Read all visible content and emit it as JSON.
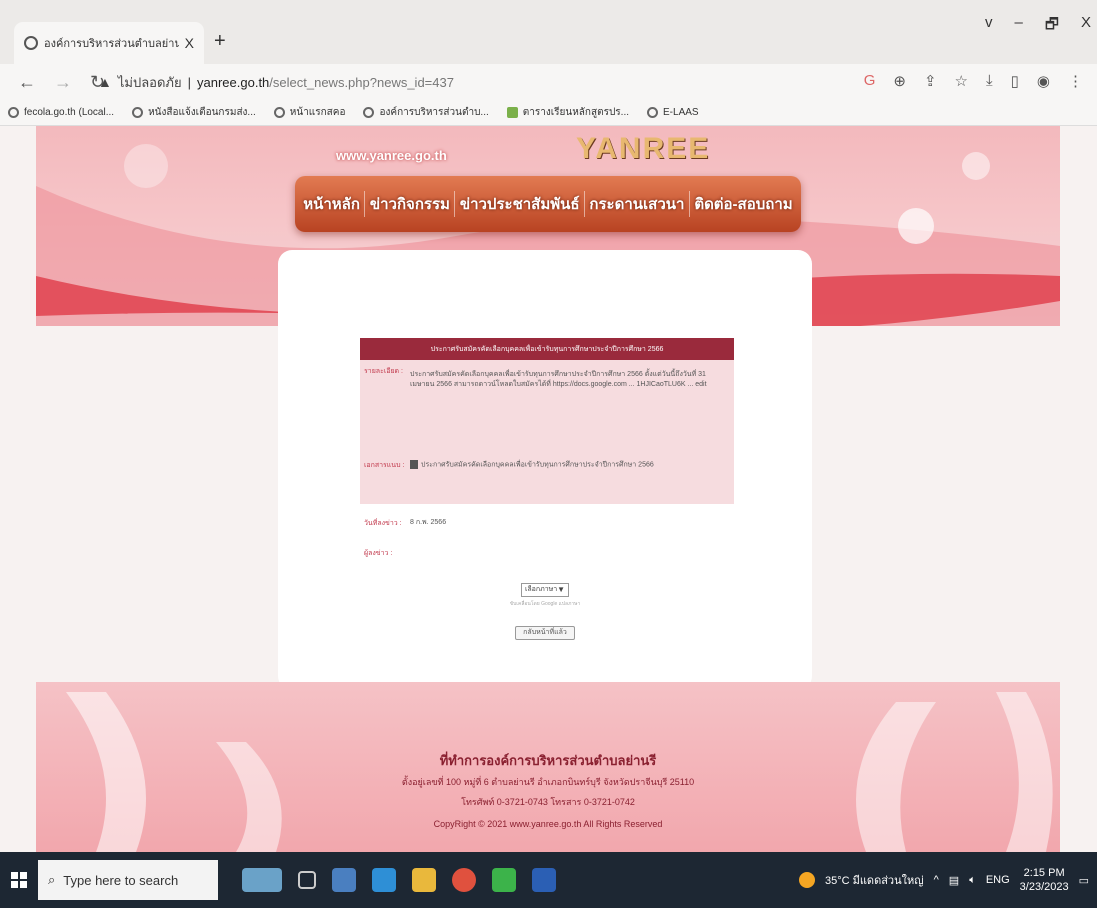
{
  "browser": {
    "tab_title": "องค์การบริหารส่วนตำบลย่านรี อำเภอ",
    "tab_close": "X",
    "new_tab": "+",
    "window_controls": [
      "v",
      "–",
      "🗗",
      "X"
    ],
    "address": {
      "secure_text": "ไม่ปลอดภัย",
      "separator": "|",
      "host": "yanree.go.th",
      "path": "/select_news.php?news_id=437"
    },
    "bookmarks": [
      "fecola.go.th (Local...",
      "หนังสือแจ้งเตือนกรมส่ง...",
      "หน้าแรกสคอ",
      "องค์การบริหารส่วนตำบ...",
      "ตารางเรียนหลักสูตรปร...",
      "E-LAAS"
    ]
  },
  "site": {
    "domain": "www.yanree.go.th",
    "logo_text": "YANREE",
    "menu": [
      "หน้าหลัก",
      "ข่าวกิจกรรม",
      "ข่าวประชาสัมพันธ์",
      "กระดานเสวนา",
      "ติดต่อ-สอบถาม"
    ]
  },
  "news": {
    "header": "ประกาศรับสมัครคัดเลือกบุคคลเพื่อเข้ารับทุนการศึกษาประจำปีการศึกษา 2566",
    "detail_label": "รายละเอียด :",
    "detail_text": "ประกาศรับสมัครคัดเลือกบุคคลเพื่อเข้ารับทุนการศึกษาประจำปีการศึกษา 2566 ตั้งแต่วันนี้ถึงวันที่ 31 เมษายน 2566 สามารถดาวน์โหลดใบสมัครได้ที่ https://docs.google.com ... 1HJICaoTLU6K ... edit",
    "attach_label": "เอกสารแนบ :",
    "attach_text": "ประกาศรับสมัครคัดเลือกบุคคลเพื่อเข้ารับทุนการศึกษาประจำปีการศึกษา 2566",
    "date_label": "วันที่ลงข่าว :",
    "date_value": "8 ก.พ. 2566",
    "poster_label": "ผู้ลงข่าว :",
    "poster_value": ""
  },
  "controls": {
    "language_select": "เลือกภาษา",
    "powered_by": "ขับเคลื่อนโดย Google แปลภาษา",
    "back_button": "กลับหน้าที่แล้ว"
  },
  "footer": {
    "title": "ที่ทำการองค์การบริหารส่วนตำบลย่านรี",
    "address": "ตั้งอยู่เลขที่ 100 หมู่ที่ 6 ตำบลย่านรี อำเภอกบินทร์บุรี จังหวัดปราจีนบุรี 25110",
    "phone": "โทรศัพท์ 0-3721-0743 โทรสาร 0-3721-0742",
    "copyright": "CopyRight © 2021 www.yanree.go.th All Rights Reserved"
  },
  "taskbar": {
    "search_placeholder": "Type here to search",
    "weather": "35°C มีแดดส่วนใหญ่",
    "language": "ENG",
    "time": "2:15 PM",
    "date": "3/23/2023"
  },
  "colors": {
    "menu": "#c1532e",
    "news_header": "#9a2a3c",
    "label": "#c23a4d",
    "banner": "#f3b9bd",
    "taskbar": "#1d2733"
  }
}
